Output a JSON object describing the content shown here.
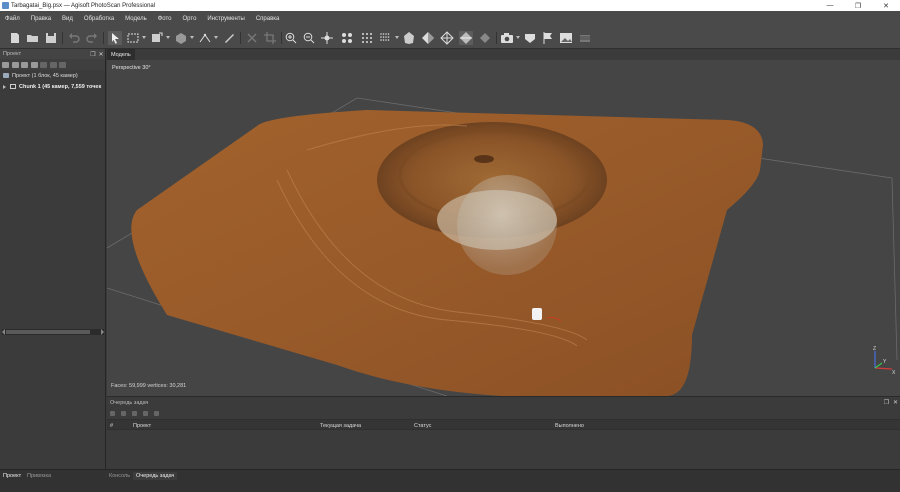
{
  "window": {
    "title": "Tarbagatai_Big.psx — Agisoft PhotoScan Professional",
    "minimize": "—",
    "maximize": "❐",
    "close": "✕"
  },
  "menu": [
    "Файл",
    "Правка",
    "Вид",
    "Обработка",
    "Модель",
    "Фото",
    "Орто",
    "Инструменты",
    "Справка"
  ],
  "toolbar": {
    "icons": [
      "new-file-icon",
      "open-folder-icon",
      "save-icon",
      "undo-icon",
      "redo-icon",
      "navigation-arrow-icon",
      "rectangle-selection-icon",
      "resize-region-icon",
      "rotate-region-icon",
      "ruler-icon",
      "measure-icon",
      "delete-icon",
      "crop-icon",
      "zoom-in-icon",
      "zoom-out-icon",
      "move-object-icon",
      "reset-view-icon",
      "show-points-icon",
      "show-dense-cloud-icon",
      "shaded-icon",
      "solid-icon",
      "wireframe-icon",
      "textured-icon",
      "tiled-icon",
      "show-cameras-icon",
      "show-shapes-icon",
      "show-markers-icon",
      "show-images-icon",
      "show-region-icon"
    ]
  },
  "workspace": {
    "panel_title": "Проект",
    "project_label": "Проект (1 блок, 45 камер)",
    "chunk_name": "Chunk 1",
    "chunk_details": "(45 камер, 7,559 точек"
  },
  "viewport": {
    "tab": "Модель",
    "projection": "Perspective 30°",
    "info": "Faces: 59,999 vertices: 30,281",
    "axes": {
      "z": "Z",
      "y": "Y",
      "x": "X"
    }
  },
  "tasks": {
    "panel_title": "Очередь задач",
    "columns": [
      "#",
      "Проект",
      "Текущая задача",
      "Статус",
      "Выполнено"
    ]
  },
  "bottom_tabs": {
    "left": [
      "Проект",
      "Привязка"
    ],
    "right": [
      "Консоль",
      "Очередь задач"
    ]
  },
  "colors": {
    "terrain": "#9a5b2a",
    "viewport_bg": "#454545",
    "panel_bg": "#3b3b3b",
    "axis_x": "#d23c3c",
    "axis_y": "#3cc850",
    "axis_z": "#4a70e0"
  }
}
